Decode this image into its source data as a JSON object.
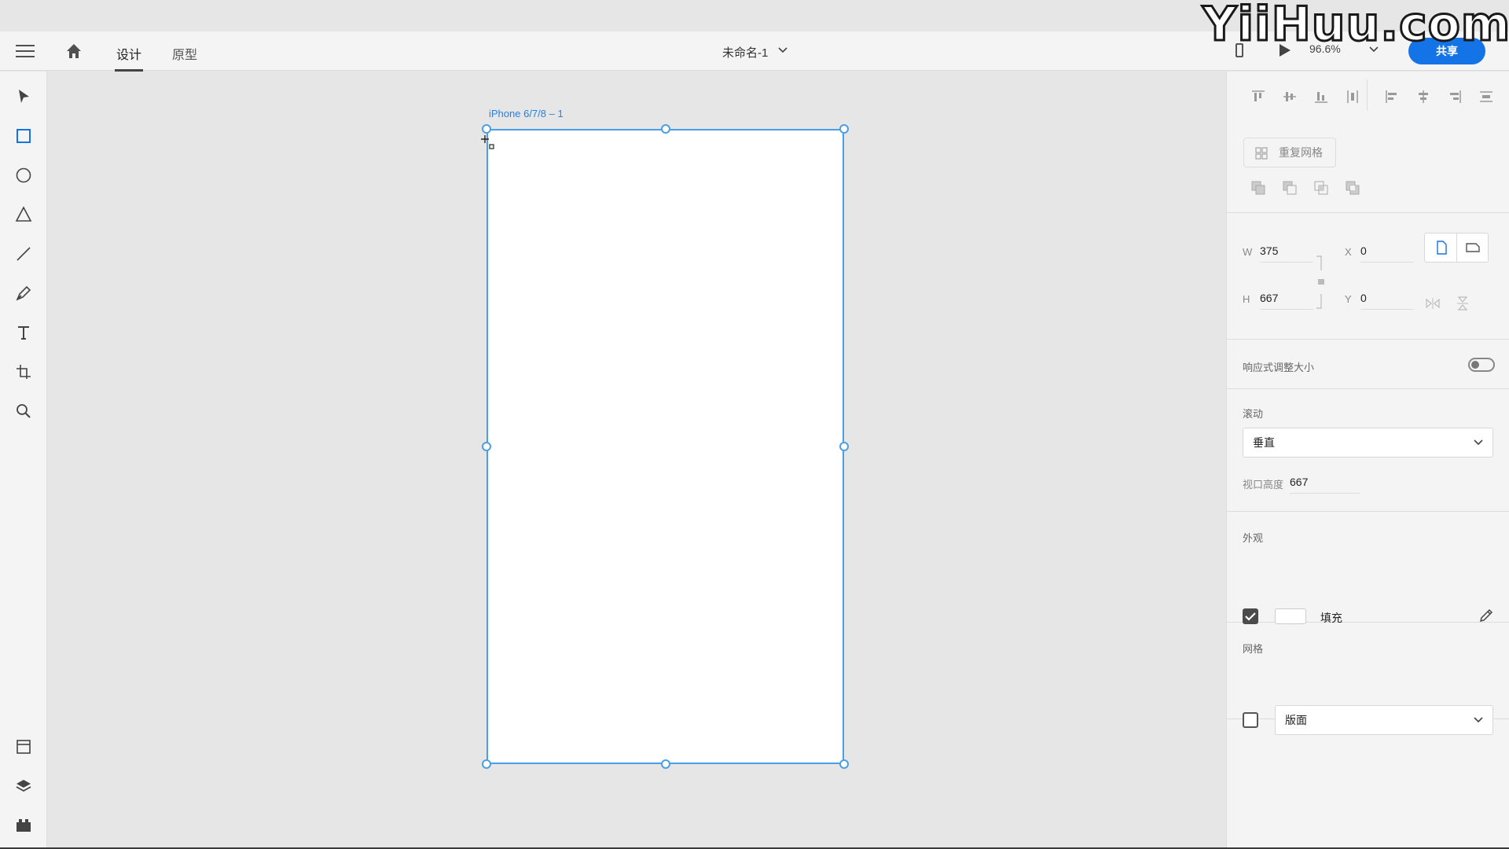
{
  "watermark": "YiiHuu.com",
  "header": {
    "tabs": [
      {
        "label": "设计"
      },
      {
        "label": "原型"
      }
    ],
    "document_title": "未命名-1",
    "zoom": "96.6%",
    "share_label": "共享"
  },
  "tools": [
    "select-tool",
    "rectangle-tool",
    "ellipse-tool",
    "polygon-tool",
    "line-tool",
    "pen-tool",
    "text-tool",
    "artboard-tool",
    "zoom-tool",
    "assets-panel",
    "layers-panel",
    "plugins-panel"
  ],
  "canvas": {
    "artboard_label": "iPhone 6/7/8 – 1"
  },
  "panel": {
    "repeat_grid_label": "重复网格",
    "width_label": "W",
    "width_value": "375",
    "height_label": "H",
    "height_value": "667",
    "x_label": "X",
    "x_value": "0",
    "y_label": "Y",
    "y_value": "0",
    "responsive_label": "响应式调整大小",
    "responsive_enabled": false,
    "scroll_title": "滚动",
    "scroll_value": "垂直",
    "viewport_label": "视口高度",
    "viewport_value": "667",
    "appearance_title": "外观",
    "fill_label": "填充",
    "fill_color": "#ffffff",
    "fill_enabled": true,
    "grid_title": "网格",
    "grid_value": "版面",
    "grid_enabled": false
  },
  "colors": {
    "accent": "#1473e6",
    "selection": "#4a9fe8"
  }
}
